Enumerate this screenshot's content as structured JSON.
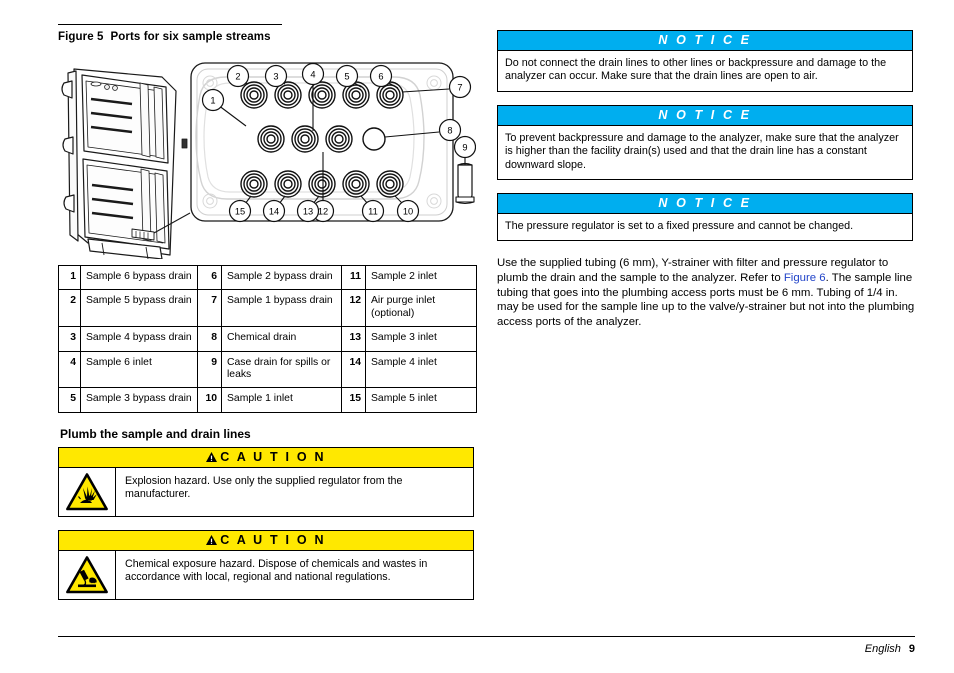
{
  "figure": {
    "caption_number": "Figure 5",
    "caption_title": "Ports for six sample streams",
    "callouts": [
      "1",
      "2",
      "3",
      "4",
      "5",
      "6",
      "7",
      "8",
      "9",
      "10",
      "11",
      "12",
      "13",
      "14",
      "15"
    ]
  },
  "ports_table": {
    "rows": [
      [
        {
          "num": "1",
          "text": "Sample 6 bypass drain"
        },
        {
          "num": "6",
          "text": "Sample 2 bypass drain"
        },
        {
          "num": "11",
          "text": "Sample 2 inlet"
        }
      ],
      [
        {
          "num": "2",
          "text": "Sample 5 bypass drain"
        },
        {
          "num": "7",
          "text": "Sample 1 bypass drain"
        },
        {
          "num": "12",
          "text": "Air purge inlet (optional)"
        }
      ],
      [
        {
          "num": "3",
          "text": "Sample 4 bypass drain"
        },
        {
          "num": "8",
          "text": "Chemical drain"
        },
        {
          "num": "13",
          "text": "Sample 3 inlet"
        }
      ],
      [
        {
          "num": "4",
          "text": "Sample 6 inlet"
        },
        {
          "num": "9",
          "text": "Case drain for spills or leaks"
        },
        {
          "num": "14",
          "text": "Sample 4 inlet"
        }
      ],
      [
        {
          "num": "5",
          "text": "Sample 3 bypass drain"
        },
        {
          "num": "10",
          "text": "Sample 1 inlet"
        },
        {
          "num": "15",
          "text": "Sample 5 inlet"
        }
      ]
    ]
  },
  "section": {
    "heading": "Plumb the sample and drain lines"
  },
  "cautions": [
    {
      "label": "C A U T I O N",
      "icon": "explosion-hazard-icon",
      "text": "Explosion hazard. Use only the supplied regulator from the manufacturer."
    },
    {
      "label": "C A U T I O N",
      "icon": "chemical-exposure-hazard-icon",
      "text": "Chemical exposure hazard. Dispose of chemicals and wastes in accordance with local, regional and national regulations."
    }
  ],
  "notices": [
    {
      "label": "N O T I C E",
      "text": "Do not connect the drain lines to other lines or backpressure and damage to the analyzer can occur. Make sure that the drain lines are open to air."
    },
    {
      "label": "N O T I C E",
      "text": "To prevent backpressure and damage to the analyzer, make sure that the analyzer is higher than the facility drain(s) used and that the drain line has a constant downward slope."
    },
    {
      "label": "N O T I C E",
      "text": "The pressure regulator is set to a fixed pressure and cannot be changed."
    }
  ],
  "paragraph": {
    "part1": "Use the supplied tubing (6 mm), Y-strainer with filter and pressure regulator to plumb the drain and the sample to the analyzer. Refer to ",
    "link": "Figure 6",
    "part2": ". The sample line tubing that goes into the plumbing access ports must be 6 mm. Tubing of 1/4 in. may be used for the sample line up to the valve/y-strainer but not into the plumbing access ports of the analyzer."
  },
  "footer": {
    "language": "English",
    "page": "9"
  },
  "colors": {
    "notice_bar": "#00aeef",
    "caution_bar": "#ffe800",
    "link": "#2143c8"
  }
}
